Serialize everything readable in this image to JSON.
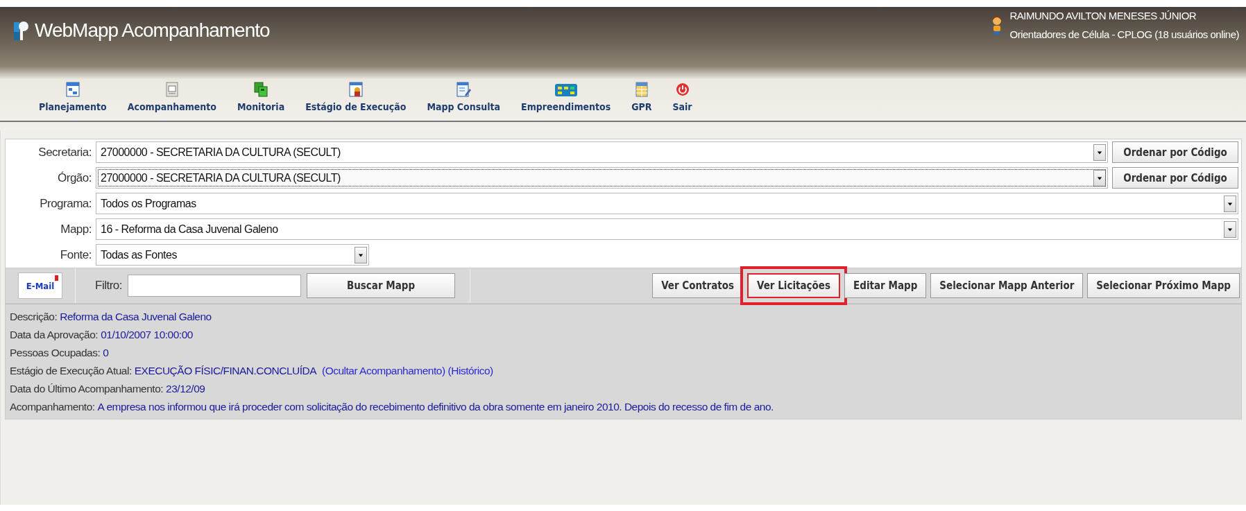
{
  "header": {
    "title": "WebMapp Acompanhamento",
    "user": "RAIMUNDO AVILTON MENESES JÚNIOR",
    "group": "Orientadores de Célula - CPLOG (18 usuários online)"
  },
  "toolbar": [
    {
      "label": "Planejamento"
    },
    {
      "label": "Acompanhamento"
    },
    {
      "label": "Monitoria"
    },
    {
      "label": "Estágio de Execução"
    },
    {
      "label": "Mapp Consulta"
    },
    {
      "label": "Empreendimentos"
    },
    {
      "label": "GPR"
    },
    {
      "label": "Sair"
    }
  ],
  "filters": [
    {
      "label": "Secretaria:",
      "value": "27000000 - SECRETARIA DA CULTURA (SECULT)",
      "focused": false,
      "kind": "wide",
      "sort_button": "Ordenar por Código"
    },
    {
      "label": "Órgão:",
      "value": "27000000 - SECRETARIA DA CULTURA (SECULT)",
      "focused": true,
      "kind": "wide",
      "sort_button": "Ordenar por Código"
    },
    {
      "label": "Programa:",
      "value": "Todos os Programas",
      "focused": false,
      "kind": "wide"
    },
    {
      "label": "Mapp:",
      "value": "16 - Reforma da Casa Juvenal Galeno",
      "focused": false,
      "kind": "wide"
    },
    {
      "label": "Fonte:",
      "value": "Todas as Fontes",
      "focused": false,
      "kind": "short"
    }
  ],
  "actions": {
    "email": "E-Mail",
    "filter_label": "Filtro:",
    "search_button": "Buscar Mapp",
    "buttons": [
      {
        "label": "Ver Contratos",
        "highlighted": false
      },
      {
        "label": "Ver Licitações",
        "highlighted": true
      },
      {
        "label": "Editar Mapp",
        "highlighted": false
      },
      {
        "label": "Selecionar Mapp Anterior",
        "highlighted": false
      },
      {
        "label": "Selecionar Próximo Mapp",
        "highlighted": false
      }
    ]
  },
  "details": [
    {
      "label": "Descrição:",
      "value": "Reforma da Casa Juvenal Galeno"
    },
    {
      "label": "Data da Aprovação:",
      "value": "01/10/2007 10:00:00"
    },
    {
      "label": "Pessoas Ocupadas:",
      "value": "0"
    },
    {
      "label": "Estágio de Execução Atual:",
      "value": "EXECUÇÃO FÍSIC/FINAN.CONCLUÍDA",
      "links": [
        "(Ocultar Acompanhamento)",
        "(Histórico)"
      ]
    },
    {
      "label": "Data do Último Acompanhamento:",
      "value": "23/12/09"
    },
    {
      "label": "Acompanhamento:",
      "value": "A empresa nos informou que irá proceder com solicitação do recebimento definitivo da obra somente em janeiro 2010. Depois do recesso de fim de ano."
    }
  ]
}
